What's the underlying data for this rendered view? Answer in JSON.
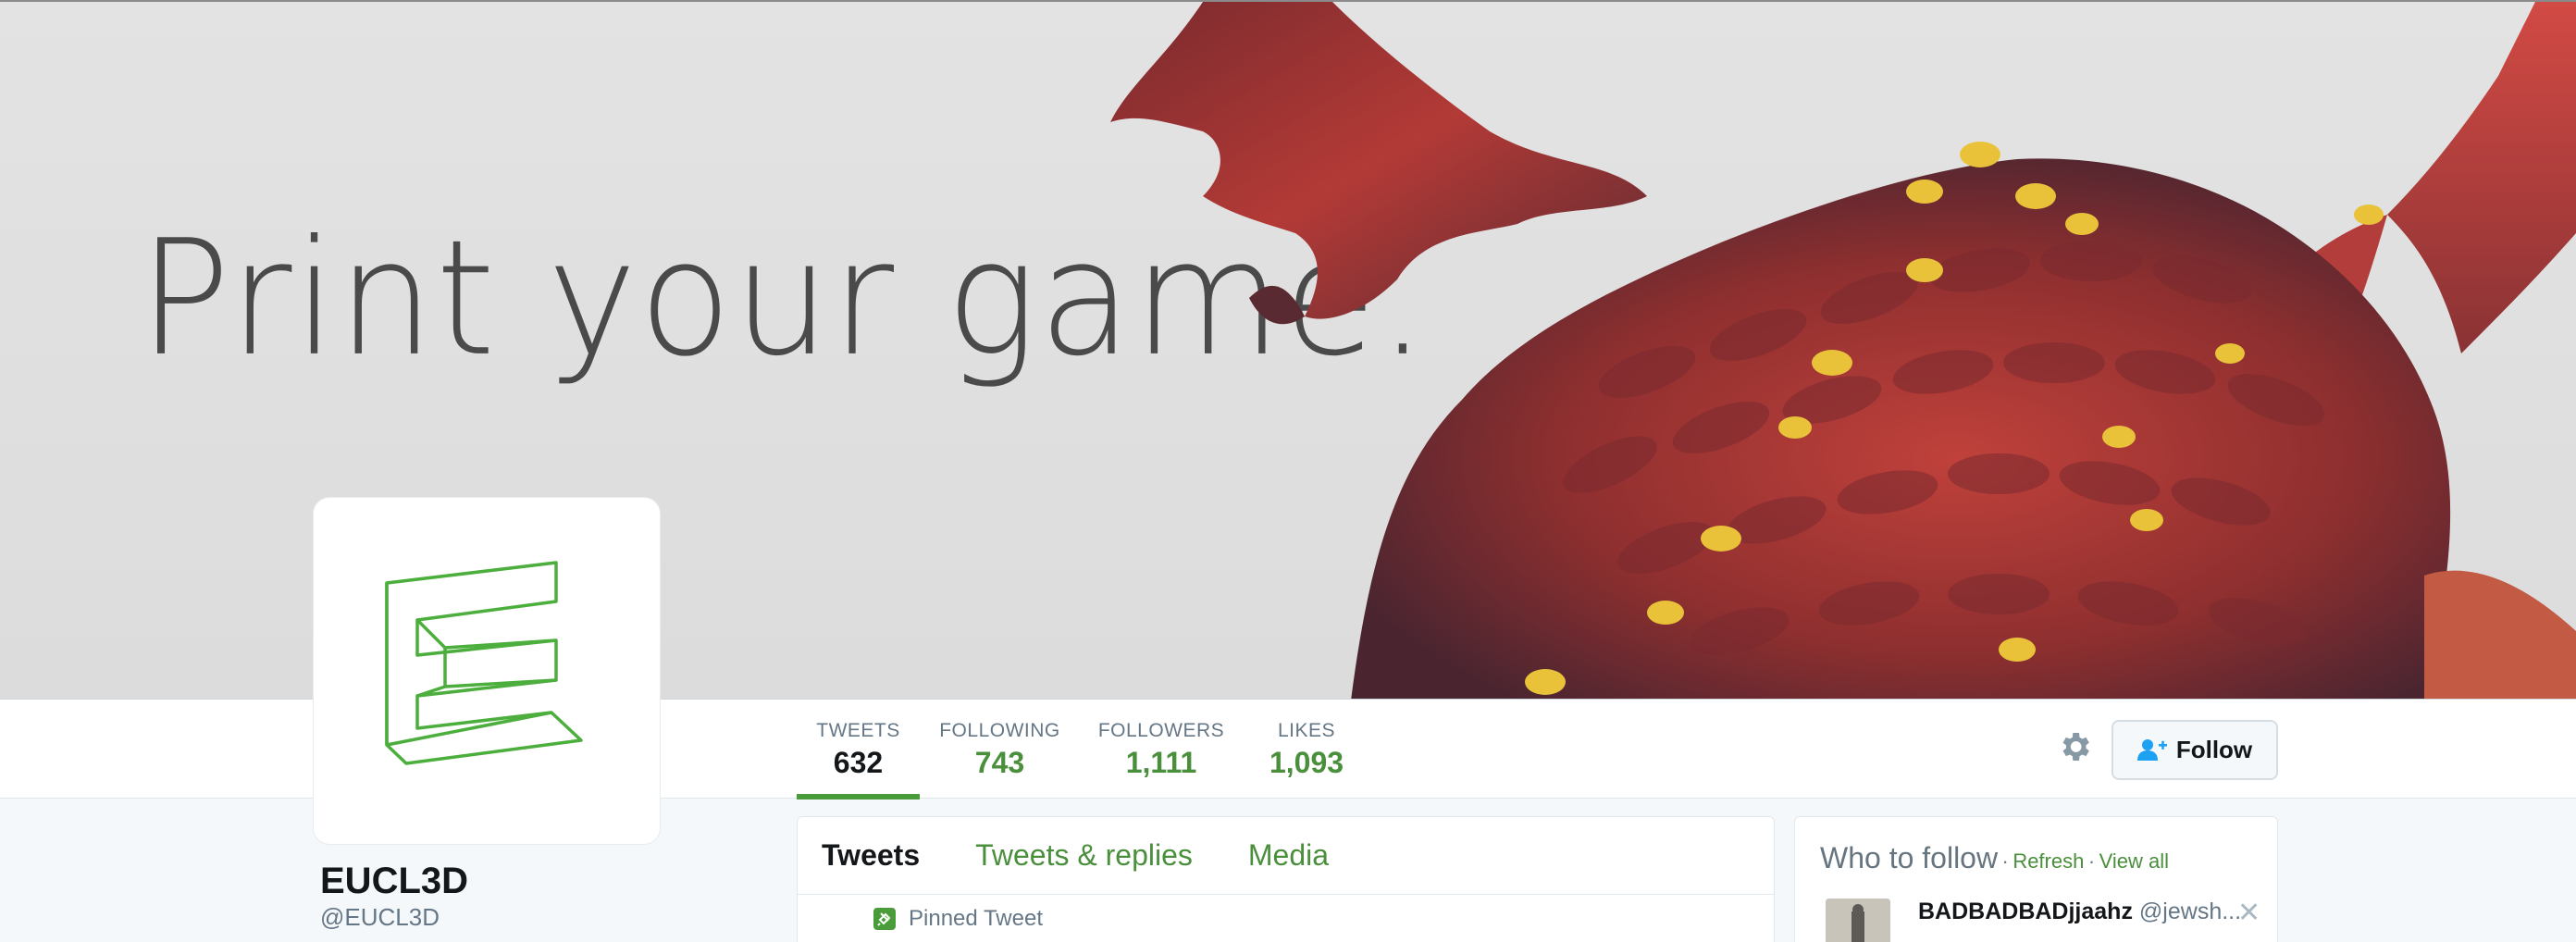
{
  "banner": {
    "slogan": "Print your game."
  },
  "stats": [
    {
      "label": "TWEETS",
      "value": "632"
    },
    {
      "label": "FOLLOWING",
      "value": "743"
    },
    {
      "label": "FOLLOWERS",
      "value": "1,111"
    },
    {
      "label": "LIKES",
      "value": "1,093"
    }
  ],
  "actions": {
    "follow_label": "Follow",
    "settings_icon": "gear-icon",
    "follow_icon": "add-user-icon"
  },
  "profile": {
    "name": "EUCL3D",
    "handle": "@EUCL3D"
  },
  "timeline": {
    "tabs": [
      "Tweets",
      "Tweets & replies",
      "Media"
    ],
    "pinned_label": "Pinned Tweet"
  },
  "who_to_follow": {
    "title": "Who to follow",
    "refresh": "Refresh",
    "view_all": "View all",
    "separator": "·",
    "suggestion": {
      "name": "BADBADBADjjaahz",
      "handle": "@jewsh..."
    }
  },
  "colors": {
    "accent": "#4a8f3c",
    "logo": "#4cae3c",
    "text": "#14171a",
    "muted": "#657786"
  }
}
